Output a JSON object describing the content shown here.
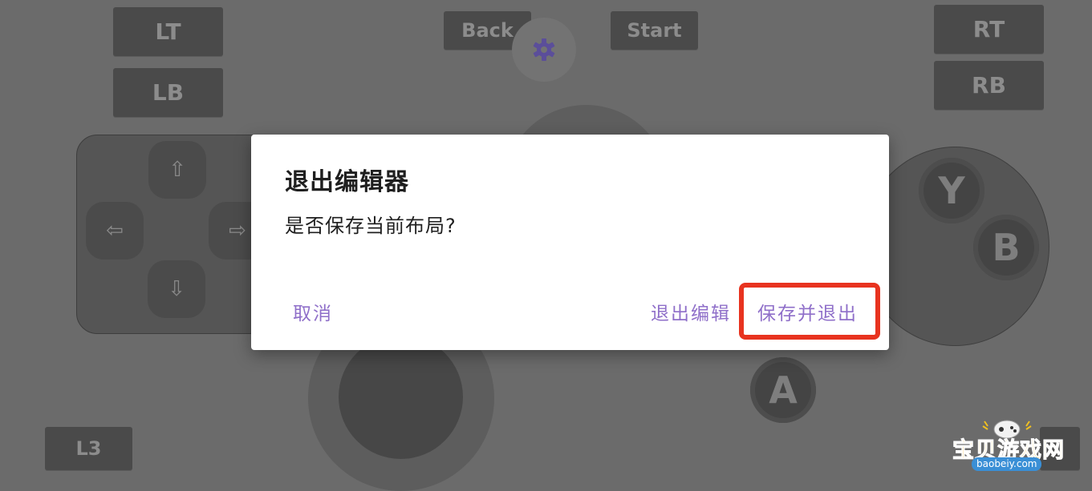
{
  "controller": {
    "lt": "LT",
    "lb": "LB",
    "back": "Back",
    "start": "Start",
    "rt": "RT",
    "rb": "RB",
    "l3": "L3",
    "dpad_up": "⇧",
    "dpad_down": "⇩",
    "dpad_left": "⇦",
    "dpad_right": "⇨",
    "y": "Y",
    "b": "B",
    "a": "A",
    "settings_icon": "gear-icon"
  },
  "dialog": {
    "title": "退出编辑器",
    "message": "是否保存当前布局?",
    "cancel": "取消",
    "exit_edit": "退出编辑",
    "save_exit": "保存并退出"
  },
  "watermark": {
    "brand": "宝贝游戏网",
    "domain": "baobeiy.com"
  },
  "colors": {
    "background": "#6b6b6b",
    "button_fill": "#4a4a4a",
    "dialog_bg": "#ffffff",
    "dialog_accent": "#8f6fc9",
    "highlight": "#e8331f"
  }
}
